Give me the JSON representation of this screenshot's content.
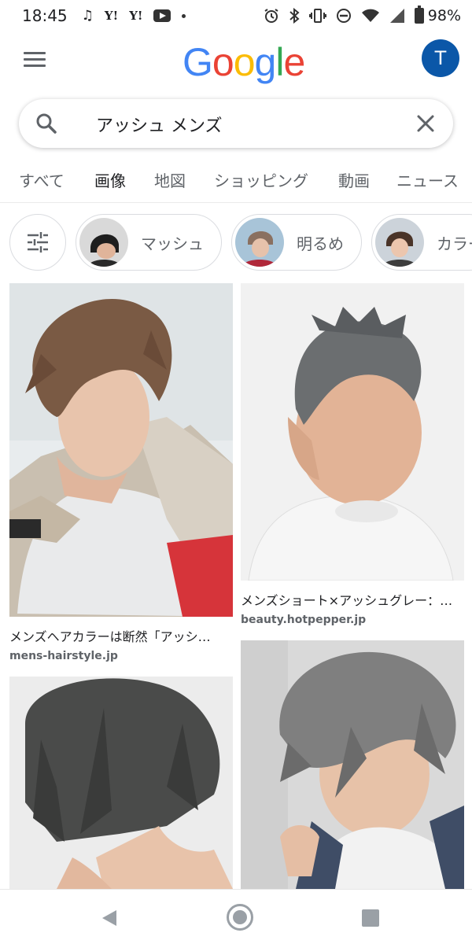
{
  "status_bar": {
    "time": "18:45",
    "battery": "98%",
    "icons_left": [
      "music-note-icon",
      "yahoo-icon",
      "yahoo-icon",
      "youtube-icon",
      "dot-icon"
    ],
    "icons_right": [
      "alarm-icon",
      "bluetooth-icon",
      "vibrate-icon",
      "dnd-icon",
      "wifi-icon",
      "signal-icon",
      "battery-icon"
    ]
  },
  "header": {
    "logo": [
      "G",
      "o",
      "o",
      "g",
      "l",
      "e"
    ],
    "avatar_letter": "T"
  },
  "search": {
    "query": "アッシュ メンズ"
  },
  "tabs": [
    {
      "label": "すべて",
      "active": false
    },
    {
      "label": "画像",
      "active": true
    },
    {
      "label": "地図",
      "active": false
    },
    {
      "label": "ショッピング",
      "active": false
    },
    {
      "label": "動画",
      "active": false
    },
    {
      "label": "ニュース",
      "active": false
    }
  ],
  "chips": [
    {
      "label": "マッシュ"
    },
    {
      "label": "明るめ"
    },
    {
      "label": "カラー"
    }
  ],
  "results": [
    {
      "title": "メンズヘアカラーは断然「アッシ…",
      "site": "mens-hairstyle.jp"
    },
    {
      "title": "メンズショート×アッシュグレー：…",
      "site": "beauty.hotpepper.jp"
    },
    {
      "title": "",
      "site": ""
    },
    {
      "title": "",
      "site": ""
    }
  ],
  "colors": {
    "google_blue": "#4285f4",
    "google_red": "#ea4335",
    "google_yellow": "#fbbc05",
    "google_green": "#34a853",
    "avatar_bg": "#0b57a8"
  }
}
